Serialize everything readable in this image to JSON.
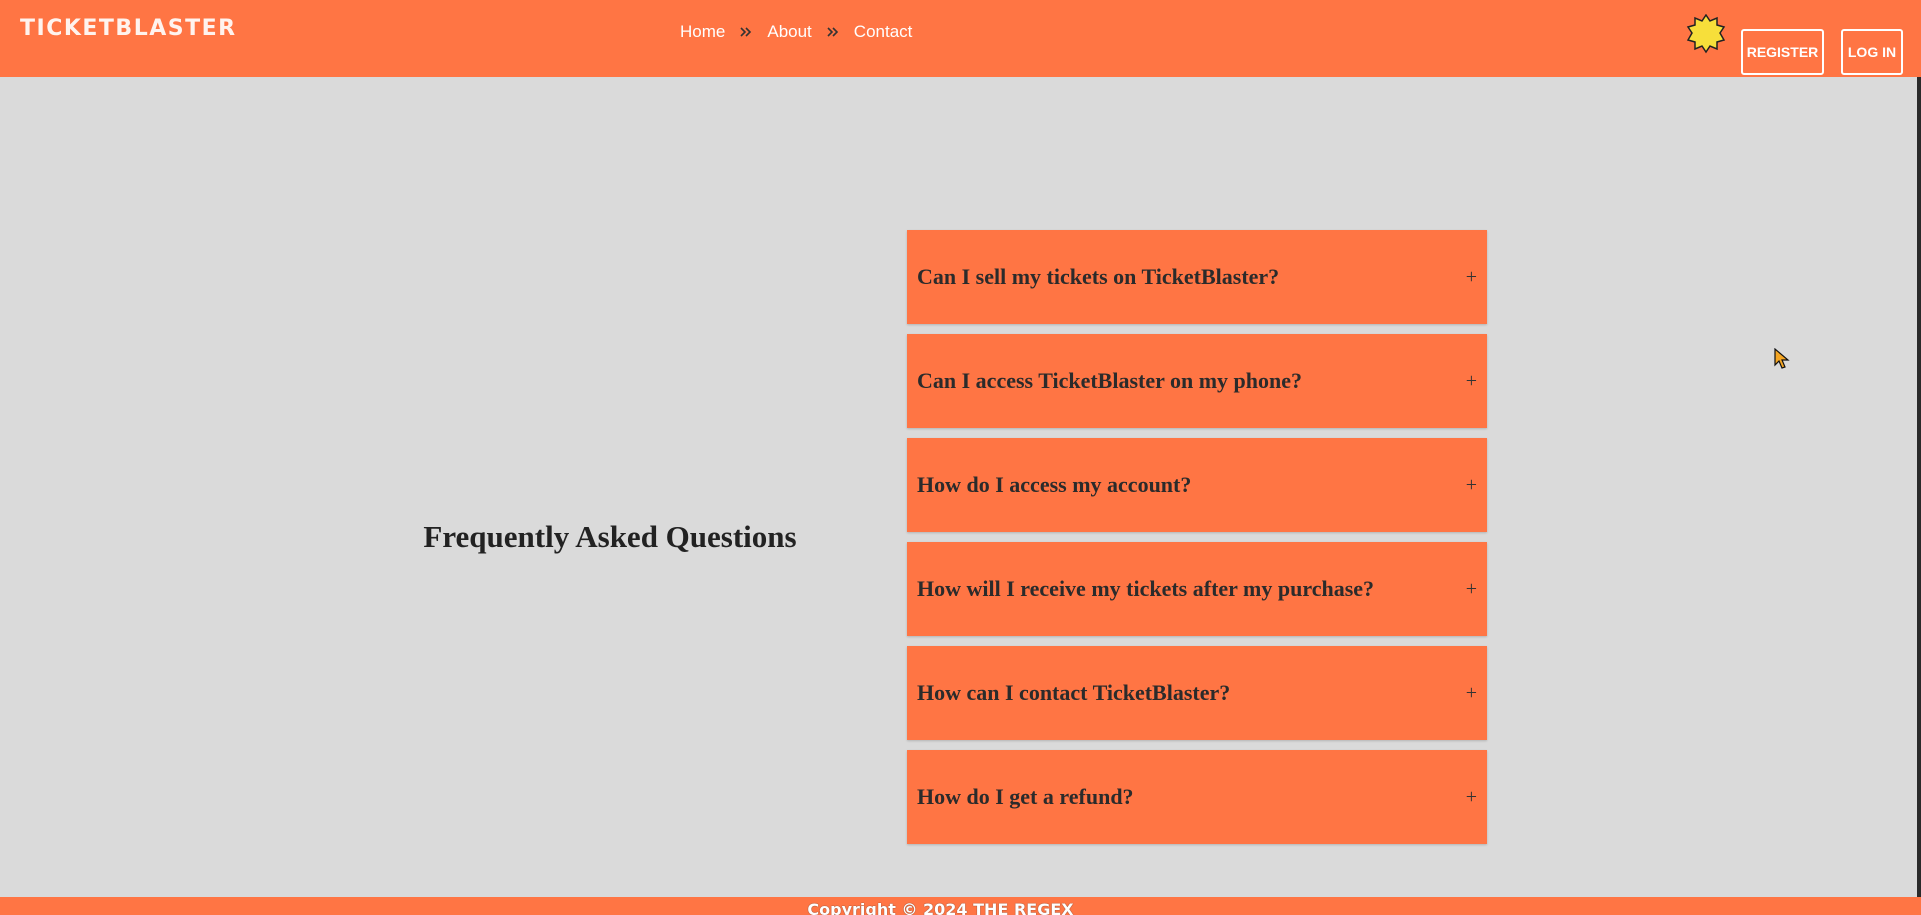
{
  "header": {
    "logo": "TICKETBLASTER",
    "nav": [
      {
        "label": "Home"
      },
      {
        "label": "About"
      },
      {
        "label": "Contact"
      }
    ],
    "theme_toggle_icon": "sun-moon-icon",
    "register_label": "REGISTER",
    "login_label": "LOG IN"
  },
  "main": {
    "title": "Frequently Asked Questions",
    "faqs": [
      {
        "question": "Can I sell my tickets on TicketBlaster?",
        "toggle": "+"
      },
      {
        "question": "Can I access TicketBlaster on my phone?",
        "toggle": "+"
      },
      {
        "question": "How do I access my account?",
        "toggle": "+"
      },
      {
        "question": "How will I receive my tickets after my purchase?",
        "toggle": "+"
      },
      {
        "question": "How can I contact TicketBlaster?",
        "toggle": "+"
      },
      {
        "question": "How do I get a refund?",
        "toggle": "+"
      }
    ]
  },
  "footer": {
    "copyright": "Copyright © 2024 THE REGEX"
  },
  "colors": {
    "brand": "#ff7544",
    "background": "#dadada",
    "text": "#222222",
    "toggle_yellow": "#f7df3a"
  }
}
